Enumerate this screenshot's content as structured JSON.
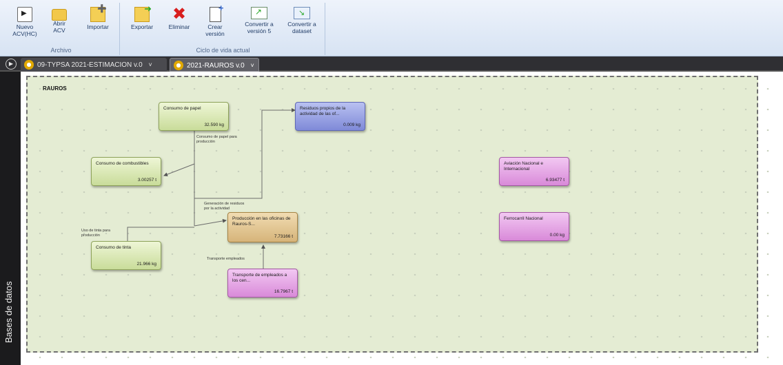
{
  "ribbon": {
    "archivo_group_title": "Archivo",
    "ciclo_group_title": "Ciclo de vida actual",
    "buttons": {
      "nuevo": "Nuevo\nACV(HC)",
      "abrir": "Abrir\nACV",
      "importar": "Importar",
      "exportar": "Exportar",
      "eliminar": "Eliminar",
      "crear": "Crear\nversión",
      "convertir5": "Convertir a\nversión 5",
      "convertir_dataset": "Convertir a\ndataset"
    }
  },
  "tabs": [
    {
      "label": "09-TYPSA 2021-ESTIMACION v.0",
      "close": "˅",
      "active": false
    },
    {
      "label": "2021-RAUROS v.0",
      "close": "˅",
      "active": true
    }
  ],
  "side_panel": {
    "label": "Bases de datos"
  },
  "canvas": {
    "title": "RAUROS",
    "nodes": {
      "papel": {
        "label": "Consumo de papel",
        "value": "32.590 kg"
      },
      "residuos": {
        "label": "Residuos propios de la actividad de las of...",
        "value": "0.009 kg"
      },
      "combustibles": {
        "label": "Consumo de combustibles",
        "value": "3.00257 t"
      },
      "produccion": {
        "label": "Producción en las oficinas de Rauros-S...",
        "value": "7.73166 t"
      },
      "tinta": {
        "label": "Consumo de tinta",
        "value": "21.966 kg"
      },
      "transporte": {
        "label": "Transporte de empleados a los cen...",
        "value": "16.7967 t"
      },
      "aviacion": {
        "label": "Aviación Nacional e Internacional",
        "value": "6.93477 t"
      },
      "ferrocarril": {
        "label": "Ferrocarril Nacional",
        "value": "0.00 kg"
      }
    },
    "edges": {
      "papel_prod": "Consumo de papel para\nproducción",
      "residuos_gen": "Generación de residuos\npor la actividad",
      "tinta_prod": "Uso de tinta para\nproducción",
      "transporte_emp": "Transporte empleados"
    }
  },
  "colors": {
    "ribbon_bg": "#dbe6f4",
    "tabstrip_bg": "#2f2f33",
    "canvas_bg": "#e4ecd3",
    "node_green": "#c9dc9a",
    "node_blue": "#7f8ad8",
    "node_tan": "#d6b47a",
    "node_pink": "#d98ad9"
  },
  "icons": [
    "new-acv-icon",
    "folder-open-icon",
    "import-icon",
    "export-icon",
    "delete-x-icon",
    "create-version-icon",
    "convert-version5-icon",
    "convert-dataset-icon",
    "tab-nav-icon",
    "document-tab-icon"
  ]
}
